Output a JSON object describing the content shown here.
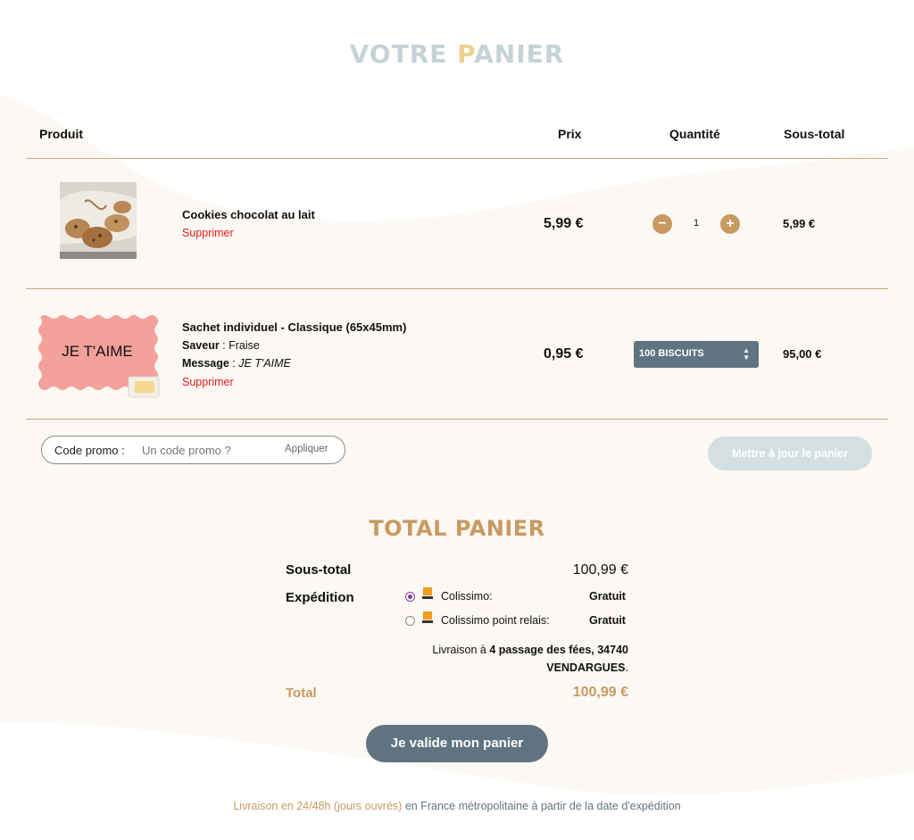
{
  "page": {
    "title_start": "VOTRE ",
    "title_accent": "P",
    "title_end": "ANIER"
  },
  "table": {
    "headers": {
      "product": "Produit",
      "price": "Prix",
      "quantity": "Quantité",
      "subtotal": "Sous-total"
    }
  },
  "items": [
    {
      "name": "Cookies chocolat au lait",
      "remove": "Supprimer",
      "price": "5,99 €",
      "quantity": "1",
      "subtotal": "5,99 €"
    },
    {
      "name": "Sachet individuel - Classique (65x45mm)",
      "image_text": "JE T'AIME",
      "flavor_label": "Saveur",
      "flavor_value": "Fraise",
      "message_label": "Message",
      "message_value": "JE T'AIME",
      "remove": "Supprimer",
      "price": "0,95 €",
      "quantity_option": "100 BISCUITS",
      "subtotal": "95,00 €"
    }
  ],
  "promo": {
    "label": "Code promo",
    "placeholder": "Un code promo ?",
    "apply": "Appliquer"
  },
  "update_button": "Mettre à jour le panier",
  "totals": {
    "title": "TOTAL PANIER",
    "subtotal_label": "Sous-total",
    "subtotal_value": "100,99 €",
    "shipping_label": "Expédition",
    "options": [
      {
        "name": "Colissimo:",
        "price": "Gratuit",
        "selected": true
      },
      {
        "name": "Colissimo point relais:",
        "price": "Gratuit",
        "selected": false
      }
    ],
    "delivery_prefix": "Livraison à ",
    "delivery_address_1": "4 passage des fées, 34740",
    "delivery_address_2": "VENDARGUES",
    "total_label": "Total",
    "total_value": "100,99 €"
  },
  "validate_button": "Je valide mon panier",
  "footer": {
    "highlight": "Livraison en 24/48h (jours ouvrés)",
    "rest": " en France métropolitaine à partir de la date d'expédition"
  },
  "colors": {
    "accent": "#c89a62",
    "slate": "#5f7480",
    "remove": "#e01b1b",
    "tag_pink": "#f3a19a"
  }
}
